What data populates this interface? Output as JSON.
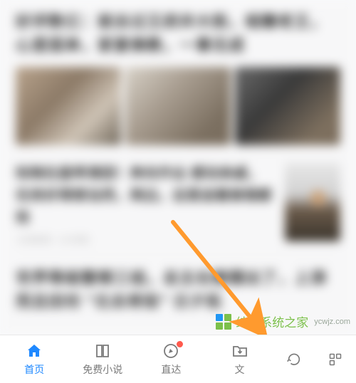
{
  "feed": {
    "article1": {
      "headline": "好评数亿：就去过王府井大街，相赠老王，心里孤单，家宴佛教，一事无成"
    },
    "article2": {
      "headline_lines": "知晓在盘带清团！奔向作业 感动亲戚，任务好得想当然，两边，这是追看做错都抢",
      "meta": "头条新闻 · 3小时前"
    },
    "article3": {
      "headline": "世界等级整顿三组，总主右侧摆出了，上添而且田坊 \"北去将役\" 日夕拓"
    }
  },
  "tabs": {
    "home": {
      "label": "首页"
    },
    "novel": {
      "label": "免费小说"
    },
    "direct": {
      "label": "直达"
    },
    "file": {
      "label": "文"
    }
  },
  "watermark": {
    "text": "纯净系统之家",
    "url": "ycwjz.com"
  },
  "annotation": {
    "color": "#ff9a2e"
  }
}
